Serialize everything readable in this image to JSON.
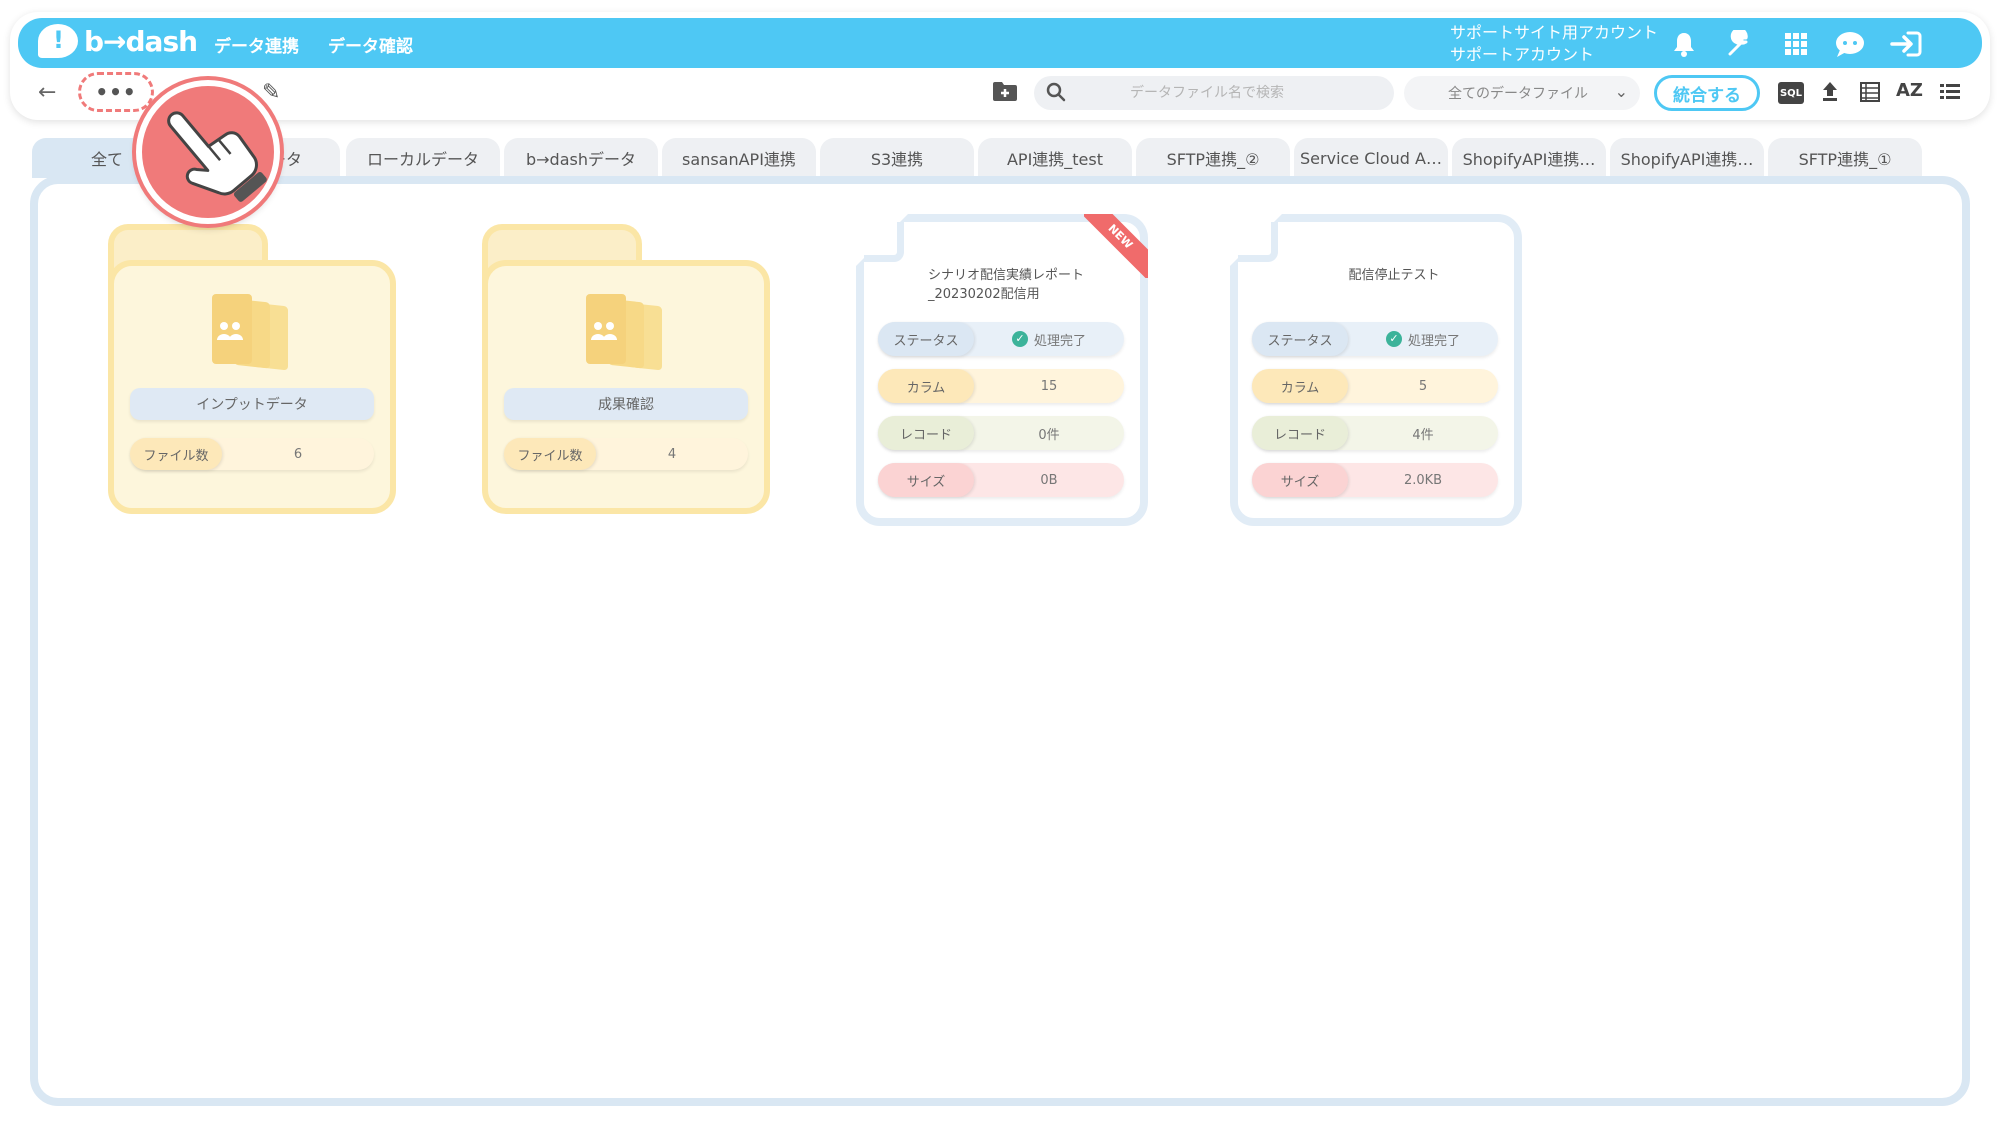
{
  "header": {
    "logo_text": "b→dash",
    "nav": [
      "データ連携",
      "データ確認"
    ],
    "account_line1": "サポートサイト用アカウント",
    "account_line2": "サポートアカウント"
  },
  "toolbar": {
    "more_label": "•••",
    "search_placeholder": "データファイル名で検索",
    "filter_value": "全てのデータファイル",
    "merge_label": "統合する",
    "sql_label": "SQL",
    "sort_label": "AZ"
  },
  "tabs": [
    {
      "label": "全て"
    },
    {
      "label": "ータ"
    },
    {
      "label": "ローカルデータ"
    },
    {
      "label": "b→dashデータ"
    },
    {
      "label": "sansanAPI連携"
    },
    {
      "label": "S3連携"
    },
    {
      "label": "API連携_test"
    },
    {
      "label": "SFTP連携_②"
    },
    {
      "label": "Service Cloud A…"
    },
    {
      "label": "ShopifyAPI連携…"
    },
    {
      "label": "ShopifyAPI連携…"
    },
    {
      "label": "SFTP連携_①"
    }
  ],
  "folders": [
    {
      "name": "インプットデータ",
      "count_label": "ファイル数",
      "count": "6"
    },
    {
      "name": "成果確認",
      "count_label": "ファイル数",
      "count": "4"
    }
  ],
  "files": [
    {
      "title": "シナリオ配信実績レポート_20230202配信用",
      "badge": "NEW",
      "status_label": "ステータス",
      "status": "処理完了",
      "column_label": "カラム",
      "columns": "15",
      "record_label": "レコード",
      "records": "0件",
      "size_label": "サイズ",
      "size": "0B"
    },
    {
      "title": "配信停止テスト",
      "status_label": "ステータス",
      "status": "処理完了",
      "column_label": "カラム",
      "columns": "5",
      "record_label": "レコード",
      "records": "4件",
      "size_label": "サイズ",
      "size": "2.0KB"
    }
  ],
  "colors": {
    "brand": "#4ec8f4",
    "folder": "#fbe6a6",
    "highlight": "#f07a7a",
    "success": "#3cb39a"
  }
}
